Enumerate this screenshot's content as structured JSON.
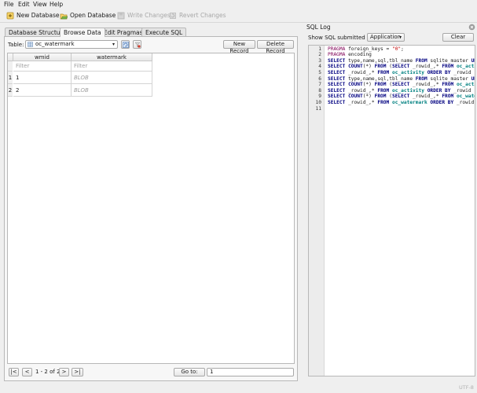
{
  "menubar": {
    "items": [
      {
        "label": "File"
      },
      {
        "label": "Edit"
      },
      {
        "label": "View"
      },
      {
        "label": "Help"
      }
    ]
  },
  "toolbar": {
    "new_database": "New Database",
    "open_database": "Open Database",
    "write_changes": "Write Changes",
    "revert_changes": "Revert Changes"
  },
  "tabs": [
    {
      "label": "Database Structure"
    },
    {
      "label": "Browse Data"
    },
    {
      "label": "Edit Pragmas"
    },
    {
      "label": "Execute SQL"
    }
  ],
  "browse": {
    "table_label": "Table:",
    "table_value": "oc_watermark",
    "new_record": "New Record",
    "delete_record": "Delete Record",
    "columns": [
      "wmid",
      "watermark"
    ],
    "filter_placeholder": "Filter",
    "rows": [
      {
        "num": "1",
        "wmid": "1",
        "watermark": "BLOB"
      },
      {
        "num": "2",
        "wmid": "2",
        "watermark": "BLOB"
      }
    ],
    "nav": {
      "first": "|<",
      "prev": "<",
      "range": "1 - 2 of 2",
      "next": ">",
      "last": ">|",
      "goto_label": "Go to:",
      "goto_value": "1"
    }
  },
  "sqllog": {
    "title": "SQL Log",
    "show_label": "Show SQL submitted by",
    "show_value": "Application",
    "clear": "Clear",
    "lines": [
      "1",
      "2",
      "3",
      "4",
      "5",
      "6",
      "7",
      "8",
      "9",
      "10",
      "11"
    ]
  },
  "status": {
    "encoding": "UTF-8"
  }
}
